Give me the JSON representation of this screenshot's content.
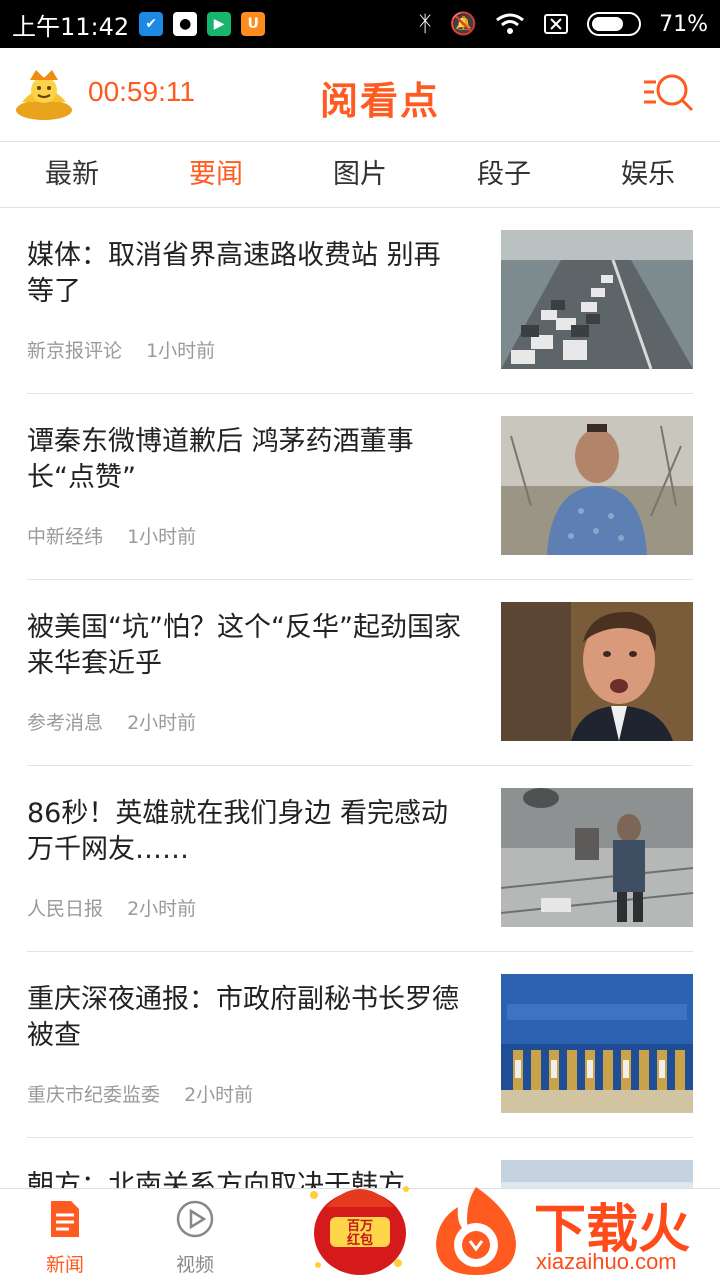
{
  "status_bar": {
    "time": "上午11:42",
    "battery": "71%",
    "battery_level": 0.71,
    "left_icons": [
      "shield-app-icon",
      "qq-icon",
      "play-app-icon",
      "uc-app-icon"
    ],
    "right_icons": [
      "bluetooth-icon",
      "mute-icon",
      "wifi-icon",
      "no-sim-icon",
      "battery-icon"
    ]
  },
  "header": {
    "timer": "00:59:11",
    "logo": "阅看点",
    "menu_icon": "menu-search-icon",
    "accent_color": "#ff5a1f"
  },
  "tabs": [
    {
      "label": "最新",
      "active": false
    },
    {
      "label": "要闻",
      "active": true
    },
    {
      "label": "图片",
      "active": false
    },
    {
      "label": "段子",
      "active": false
    },
    {
      "label": "娱乐",
      "active": false
    }
  ],
  "articles": [
    {
      "title": "媒体：取消省界高速路收费站 别再等了",
      "source": "新京报评论",
      "time": "1小时前"
    },
    {
      "title": "谭秦东微博道歉后 鸿茅药酒董事长“点赞”",
      "source": "中新经纬",
      "time": "1小时前"
    },
    {
      "title": "被美国“坑”怕？这个“反华”起劲国家来华套近乎",
      "source": "参考消息",
      "time": "2小时前"
    },
    {
      "title": "86秒！英雄就在我们身边 看完感动万千网友……",
      "source": "人民日报",
      "time": "2小时前"
    },
    {
      "title": "重庆深夜通报：市政府副秘书长罗德被查",
      "source": "重庆市纪委监委",
      "time": "2小时前"
    },
    {
      "title": "朝方：北南关系方向取决于韩方",
      "source": "",
      "time": ""
    }
  ],
  "bottom_nav": {
    "news_label": "新闻",
    "video_label": "视频",
    "redpacket_text": "百万红包",
    "watermark_text": "下载火",
    "watermark_domain": "xiazaihuo.com"
  }
}
